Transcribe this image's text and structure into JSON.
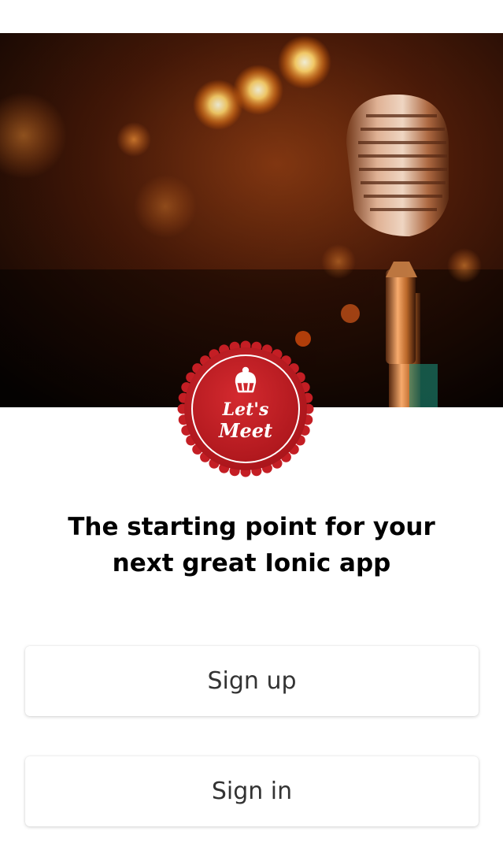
{
  "hero": {
    "image": "microphone-stage-photo",
    "colors": {
      "warm_light": "#ffb347",
      "dark": "#0a0503"
    }
  },
  "badge": {
    "icon": "cupcake-icon",
    "line1": "Let's",
    "line2": "Meet",
    "color": "#c41e24"
  },
  "headline": {
    "line1": "The starting point for your",
    "line2": "next great Ionic app"
  },
  "actions": {
    "signup_label": "Sign up",
    "signin_label": "Sign in"
  }
}
